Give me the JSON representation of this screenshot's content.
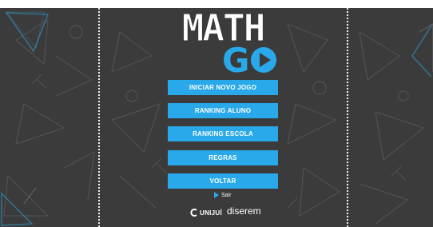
{
  "logo": {
    "word_math": "MATH",
    "word_g": "G"
  },
  "menu": {
    "buttons": [
      {
        "label": "INICIAR NOVO JOGO"
      },
      {
        "label": "RANKING ALUNO"
      },
      {
        "label": "RANKING ESCOLA"
      },
      {
        "label": "REGRAS"
      },
      {
        "label": "VOLTAR"
      }
    ],
    "exit_label": "Sair"
  },
  "footer": {
    "partner_1": "UNIJUÍ",
    "partner_2": "diserem"
  },
  "colors": {
    "background": "#3b3b3b",
    "accent": "#29a9ea",
    "text": "#ffffff"
  }
}
